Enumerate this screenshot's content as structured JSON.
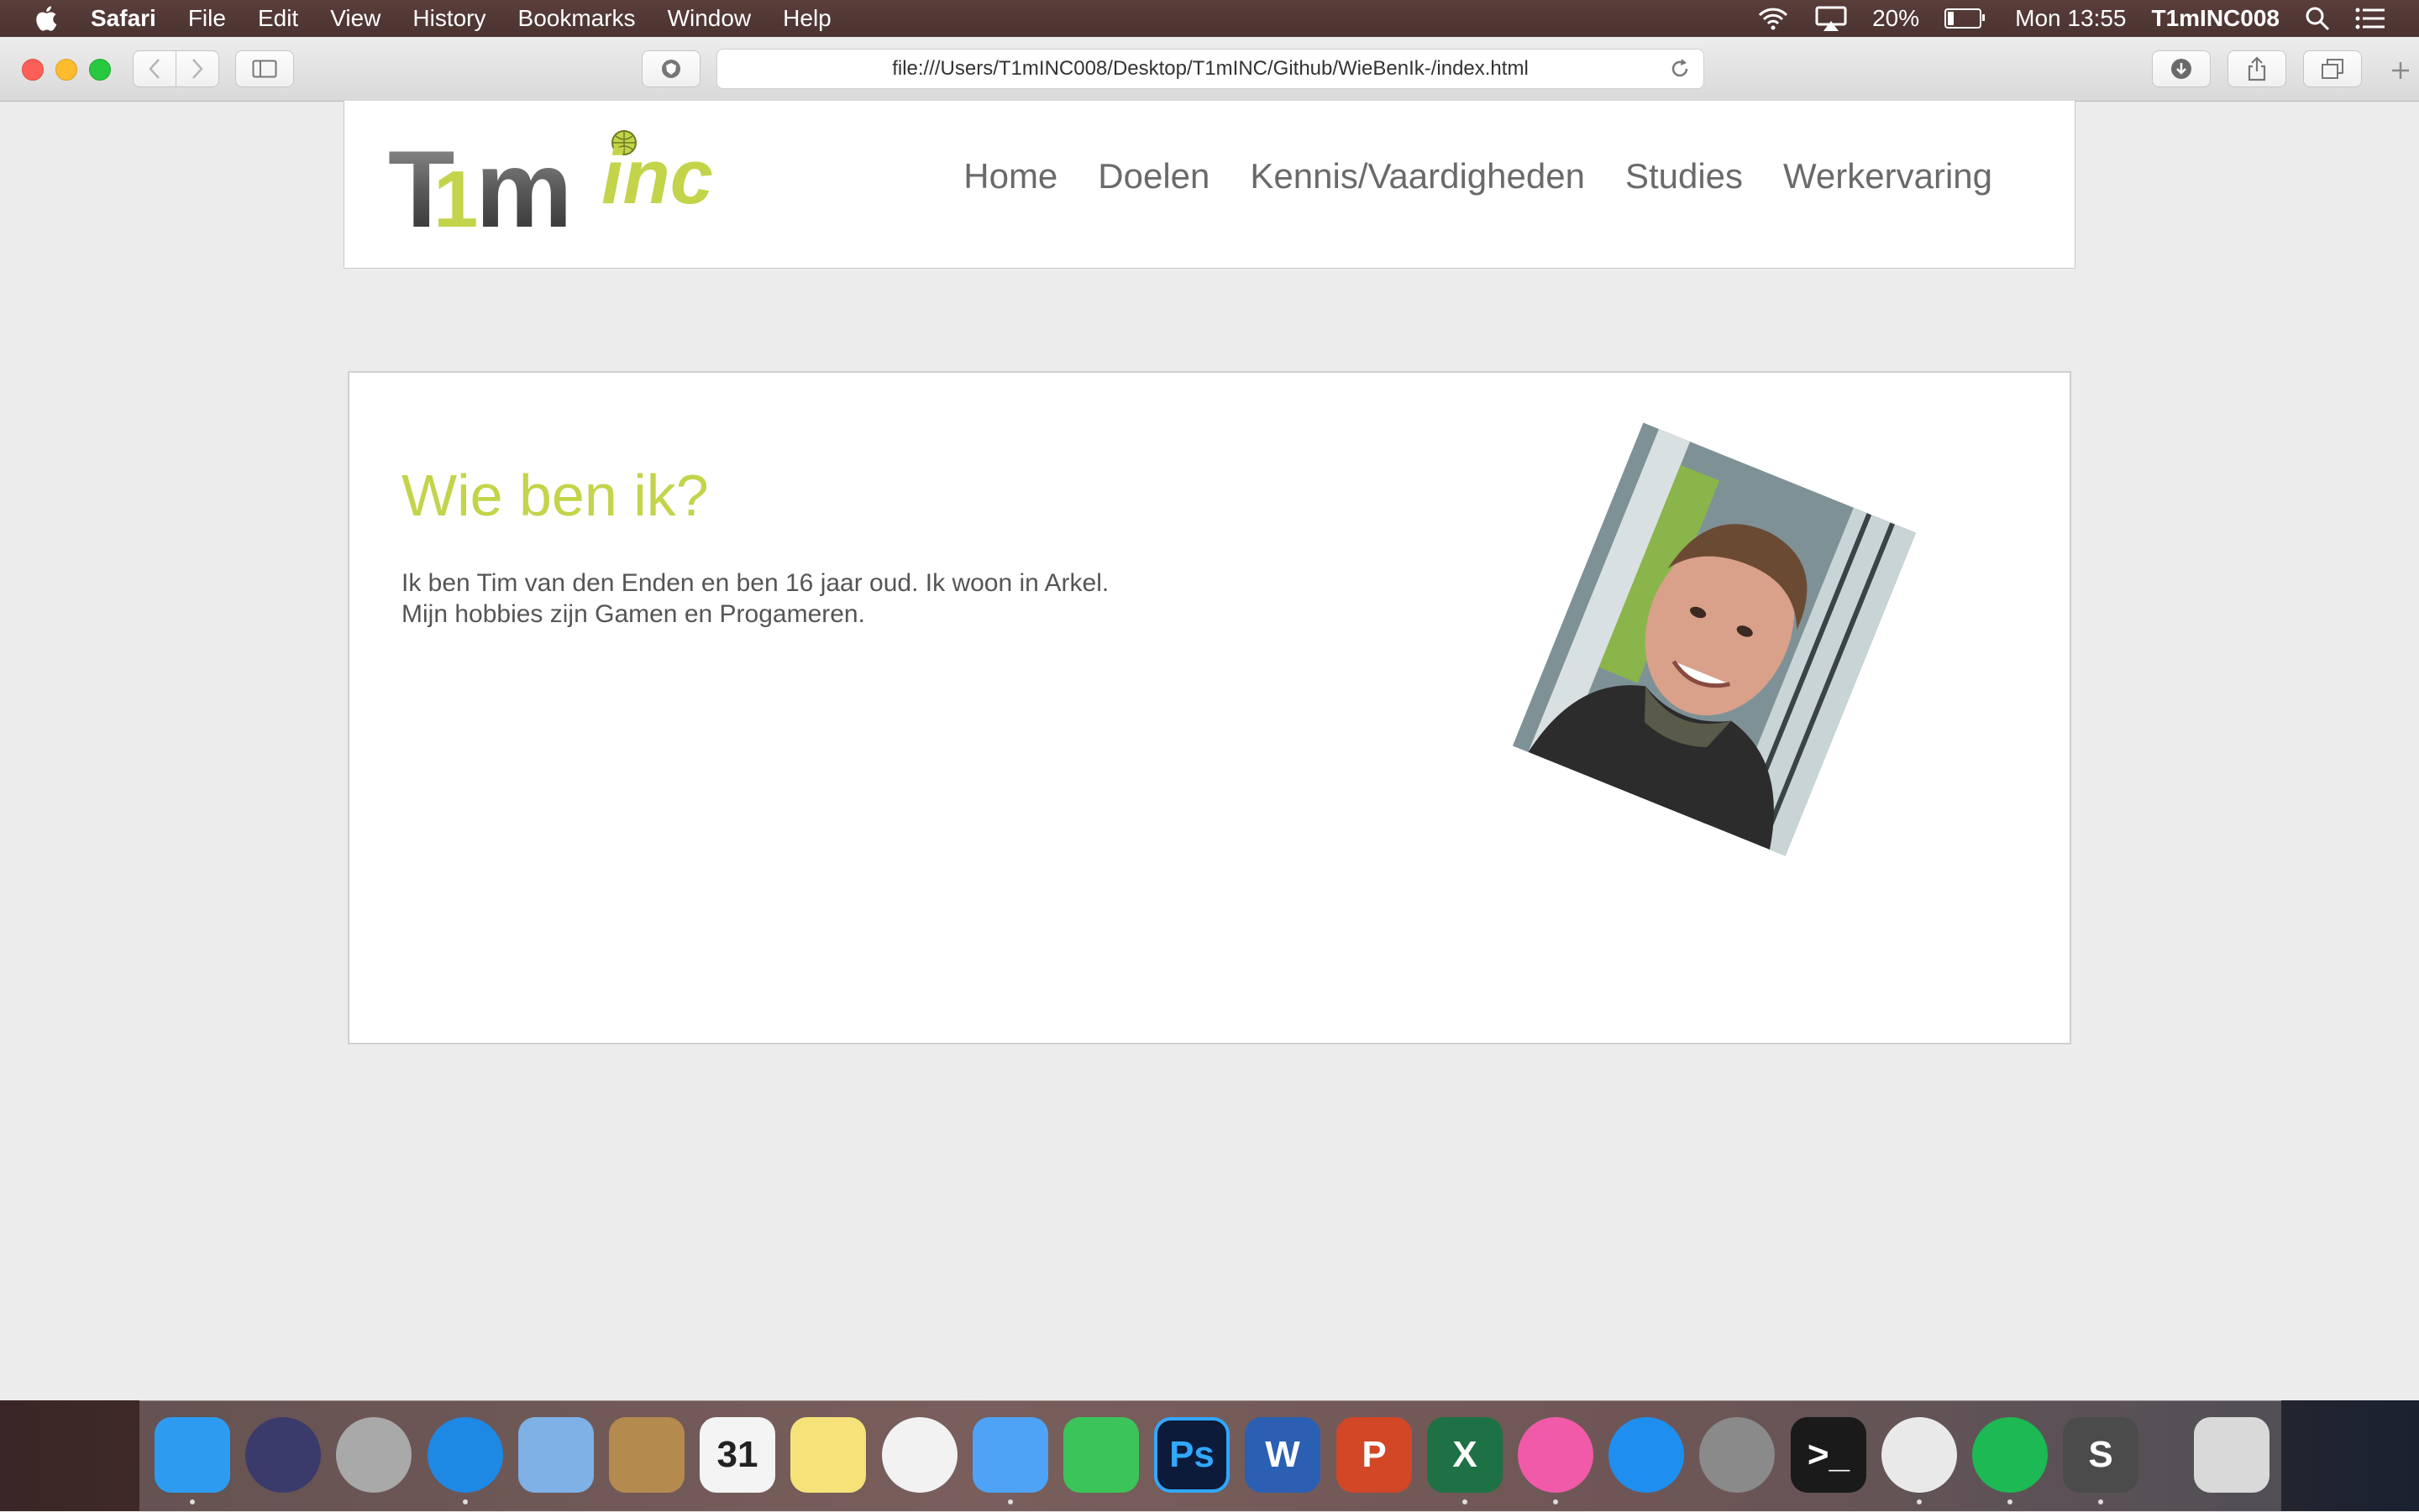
{
  "menubar": {
    "app_name": "Safari",
    "menus": [
      "File",
      "Edit",
      "View",
      "History",
      "Bookmarks",
      "Window",
      "Help"
    ],
    "battery_percent": "20%",
    "battery_level": 0.2,
    "clock": "Mon 13:55",
    "user": "T1mINC008",
    "icons": [
      "apple-icon",
      "wifi-icon",
      "airplay-icon",
      "battery-icon",
      "spotlight-icon",
      "notification-center-icon"
    ]
  },
  "browser": {
    "url": "file:///Users/T1mINC008/Desktop/T1mINC/Github/WieBenIk-/index.html"
  },
  "site": {
    "logo": {
      "part1": "T",
      "part2": "1",
      "part3": "m",
      "part4": "inc",
      "colors": {
        "dark": "#555555",
        "accent": "#c3d44a"
      }
    },
    "nav": [
      "Home",
      "Doelen",
      "Kennis/Vaardigheden",
      "Studies",
      "Werkervaring"
    ],
    "heading": "Wie ben ik?",
    "bio_line1": "Ik ben Tim van den Enden en ben 16 jaar oud. Ik woon in Arkel.",
    "bio_line2": "Mijn hobbies zijn Gamen en Progameren.",
    "accent_color": "#c3d44a"
  },
  "dock": {
    "apps": [
      {
        "name": "finder-icon",
        "label": "",
        "color": "#2d9cf0",
        "running": true
      },
      {
        "name": "siri-icon",
        "label": "",
        "color": "#3b3b6b",
        "running": false
      },
      {
        "name": "launchpad-icon",
        "label": "",
        "color": "#a9a9a9",
        "running": false
      },
      {
        "name": "safari-icon",
        "label": "",
        "color": "#1e88e5",
        "running": true
      },
      {
        "name": "mail-icon",
        "label": "",
        "color": "#7fb1e6",
        "running": false
      },
      {
        "name": "contacts-icon",
        "label": "",
        "color": "#b58a4f",
        "running": false
      },
      {
        "name": "calendar-icon",
        "label": "31",
        "color": "#f4f4f4",
        "running": false
      },
      {
        "name": "notes-icon",
        "label": "",
        "color": "#f7e27a",
        "running": false
      },
      {
        "name": "photos-icon",
        "label": "",
        "color": "#f2f2f2",
        "running": false
      },
      {
        "name": "messages-icon",
        "label": "",
        "color": "#4ea3f7",
        "running": true
      },
      {
        "name": "facetime-icon",
        "label": "",
        "color": "#3bc45a",
        "running": false
      },
      {
        "name": "photoshop-icon",
        "label": "Ps",
        "color": "#0c1b3a",
        "running": false
      },
      {
        "name": "word-icon",
        "label": "W",
        "color": "#2b5fb3",
        "running": false
      },
      {
        "name": "powerpoint-icon",
        "label": "P",
        "color": "#d24726",
        "running": false
      },
      {
        "name": "excel-icon",
        "label": "X",
        "color": "#1e7145",
        "running": true
      },
      {
        "name": "itunes-icon",
        "label": "",
        "color": "#f05aa8",
        "running": true
      },
      {
        "name": "app-store-icon",
        "label": "",
        "color": "#1e8ff0",
        "running": false
      },
      {
        "name": "system-preferences-icon",
        "label": "",
        "color": "#8a8a8a",
        "running": false
      },
      {
        "name": "terminal-icon",
        "label": ">_",
        "color": "#1a1a1a",
        "running": false
      },
      {
        "name": "chrome-icon",
        "label": "",
        "color": "#e9e9e9",
        "running": true
      },
      {
        "name": "spotify-icon",
        "label": "",
        "color": "#1db954",
        "running": true
      },
      {
        "name": "sublime-text-icon",
        "label": "S",
        "color": "#4b4b4b",
        "running": true
      },
      {
        "name": "trash-icon",
        "label": "",
        "color": "#d9d9d9",
        "running": false
      }
    ]
  }
}
